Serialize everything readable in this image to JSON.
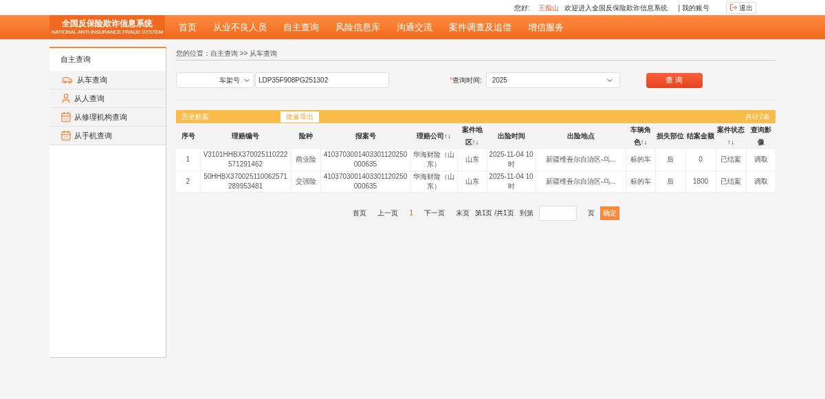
{
  "top_bar": {
    "greeting": "您好:",
    "user": "王痴山",
    "welcome": "欢迎进入全国反保险欺诈信息系统",
    "account": "| 我的账号",
    "logout": "退出"
  },
  "logo": {
    "title": "全国反保险欺诈信息系统",
    "subtitle": "NATIONAL ANTI INSURANCE FRAUD SYSTEM"
  },
  "nav": [
    "首页",
    "从业不良人员",
    "自主查询",
    "风险信息库",
    "沟通交流",
    "案件调查及追偿",
    "增信服务"
  ],
  "sidebar": {
    "title": "自主查询",
    "items": [
      {
        "label": "从车查询",
        "kind": "car"
      },
      {
        "label": "从人查询",
        "kind": "person"
      },
      {
        "label": "从修理机构查询",
        "kind": "calendar"
      },
      {
        "label": "从手机查询",
        "kind": "calendar"
      }
    ]
  },
  "breadcrumb": "您的位置：自主查询 >> 从车查询",
  "search": {
    "type": "车架号",
    "value": "LDP35F908PG251302",
    "required_mark": "*",
    "time_label": "查询时间:",
    "time_value": "2025",
    "button": "查 询"
  },
  "results": {
    "title": "历史赔案",
    "export": "批量导出",
    "total": "共计2条",
    "columns": [
      "序号",
      "理赔编号",
      "险种",
      "报案号",
      "理赔公司↑↓",
      "案件地区↑↓",
      "出险时间",
      "出险地点",
      "车辆角色↑↓",
      "损失部位",
      "结案金额",
      "案件状态↑↓",
      "查询影像"
    ],
    "rows": [
      [
        "1",
        "V3101HHBX370025110222571291462",
        "商业险",
        "4103703001403301120250000635",
        "华海财险（山东）",
        "山东",
        "2025-11-04 10时",
        "新疆维吾尔自治区-乌...",
        "标的车",
        "后",
        "0",
        "已结案",
        "调取"
      ],
      [
        "2",
        "50HHBX370025110062571289953481",
        "交强险",
        "4103703001403301120250000635",
        "华海财险（山东）",
        "山东",
        "2025-11-04 10时",
        "新疆维吾尔自治区-乌...",
        "标的车",
        "后",
        "1800",
        "已结案",
        "调取"
      ]
    ]
  },
  "pager": {
    "first": "首页",
    "prev": "上一页",
    "current": "1",
    "next": "下一页",
    "last": "末页",
    "info": "第1页 /共1页",
    "goto": "到第",
    "unit": "页",
    "confirm": "确定"
  }
}
